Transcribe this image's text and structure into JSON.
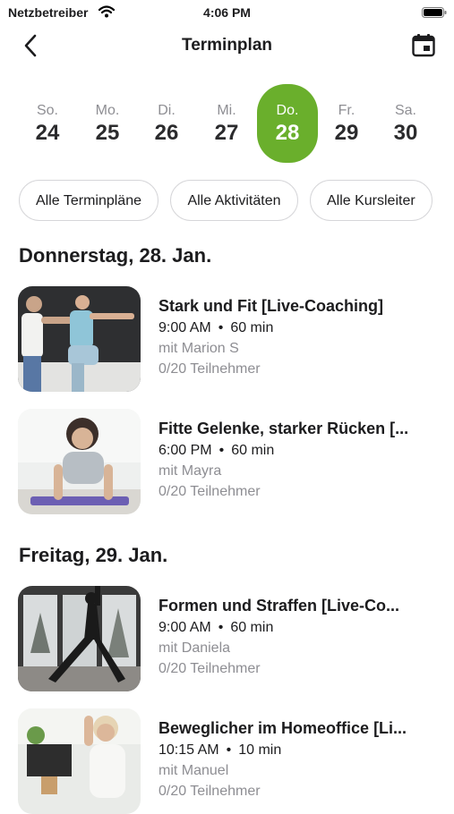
{
  "status": {
    "carrier": "Netzbetreiber",
    "time": "4:06 PM"
  },
  "nav": {
    "title": "Terminplan"
  },
  "week": [
    {
      "name": "So.",
      "num": "24",
      "selected": false
    },
    {
      "name": "Mo.",
      "num": "25",
      "selected": false
    },
    {
      "name": "Di.",
      "num": "26",
      "selected": false
    },
    {
      "name": "Mi.",
      "num": "27",
      "selected": false
    },
    {
      "name": "Do.",
      "num": "28",
      "selected": true
    },
    {
      "name": "Fr.",
      "num": "29",
      "selected": false
    },
    {
      "name": "Sa.",
      "num": "30",
      "selected": false
    }
  ],
  "filters": [
    "Alle Terminpläne",
    "Alle Aktivitäten",
    "Alle Kursleiter"
  ],
  "sections": [
    {
      "header": "Donnerstag, 28. Jan.",
      "classes": [
        {
          "title": "Stark und Fit  [Live-Coaching]",
          "time": "9:00 AM",
          "duration": "60 min",
          "trainer": "mit Marion S",
          "participants": "0/20 Teilnehmer"
        },
        {
          "title": "Fitte Gelenke, starker Rücken [...",
          "time": "6:00 PM",
          "duration": "60 min",
          "trainer": "mit Mayra",
          "participants": "0/20 Teilnehmer"
        }
      ]
    },
    {
      "header": "Freitag, 29. Jan.",
      "classes": [
        {
          "title": "Formen und Straffen [Live-Co...",
          "time": "9:00 AM",
          "duration": "60 min",
          "trainer": "mit Daniela",
          "participants": "0/20 Teilnehmer"
        },
        {
          "title": "Beweglicher im Homeoffice [Li...",
          "time": "10:15 AM",
          "duration": "10 min",
          "trainer": "mit Manuel",
          "participants": "0/20 Teilnehmer"
        }
      ]
    }
  ],
  "colors": {
    "accent": "#6aaf2c"
  },
  "icons": {
    "back": "chevron-left-icon",
    "calendar": "calendar-icon",
    "wifi": "wifi-icon",
    "battery": "battery-icon"
  }
}
